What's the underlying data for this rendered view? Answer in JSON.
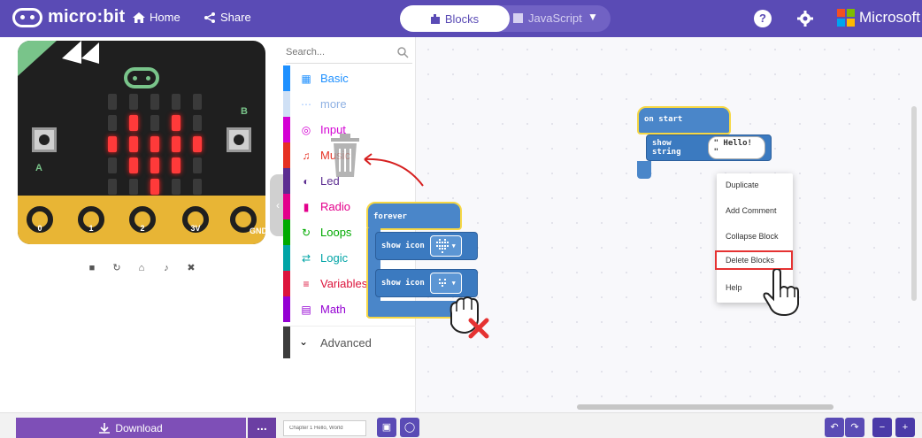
{
  "header": {
    "brand": "micro:bit",
    "home_label": "Home",
    "share_label": "Share",
    "blocks_label": "Blocks",
    "javascript_label": "JavaScript",
    "help_glyph": "?",
    "microsoft_label": "Microsoft"
  },
  "simulator": {
    "pin_labels": [
      "0",
      "1",
      "2",
      "3V",
      "GND"
    ],
    "button_a": "A",
    "button_b": "B",
    "led_matrix": [
      [
        0,
        0,
        0,
        0,
        0
      ],
      [
        0,
        1,
        0,
        1,
        0
      ],
      [
        1,
        1,
        1,
        1,
        1
      ],
      [
        0,
        1,
        1,
        1,
        0
      ],
      [
        0,
        0,
        1,
        0,
        0
      ]
    ]
  },
  "toolbox": {
    "search_placeholder": "Search...",
    "categories": [
      {
        "label": "Basic",
        "color": "#1e90ff",
        "icon": "grid-icon"
      },
      {
        "label": "more",
        "color": "#9cc3ff",
        "icon": "ellipsis-icon"
      },
      {
        "label": "Input",
        "color": "#d400d4",
        "icon": "circle-target-icon"
      },
      {
        "label": "Music",
        "color": "#e63022",
        "icon": "headphones-icon"
      },
      {
        "label": "Led",
        "color": "#5c2d91",
        "icon": "toggle-icon"
      },
      {
        "label": "Radio",
        "color": "#e3008c",
        "icon": "signal-bars-icon"
      },
      {
        "label": "Loops",
        "color": "#00aa00",
        "icon": "loop-arrow-icon"
      },
      {
        "label": "Logic",
        "color": "#00a4a6",
        "icon": "shuffle-icon"
      },
      {
        "label": "Variables",
        "color": "#dc143c",
        "icon": "list-icon"
      },
      {
        "label": "Math",
        "color": "#9400d3",
        "icon": "calculator-icon"
      }
    ],
    "advanced_label": "Advanced"
  },
  "workspace": {
    "on_start_label": "on start",
    "show_string_label": "show string",
    "string_value": "\" Hello! \"",
    "forever_label": "forever",
    "show_icon_label": "show icon"
  },
  "context_menu": {
    "items": [
      "Duplicate",
      "Add Comment",
      "Collapse Block",
      "Delete Blocks",
      "Help"
    ]
  },
  "footer": {
    "download_label": "Download",
    "more_label": "...",
    "project_name": "Chapter 1 Hello, World"
  }
}
